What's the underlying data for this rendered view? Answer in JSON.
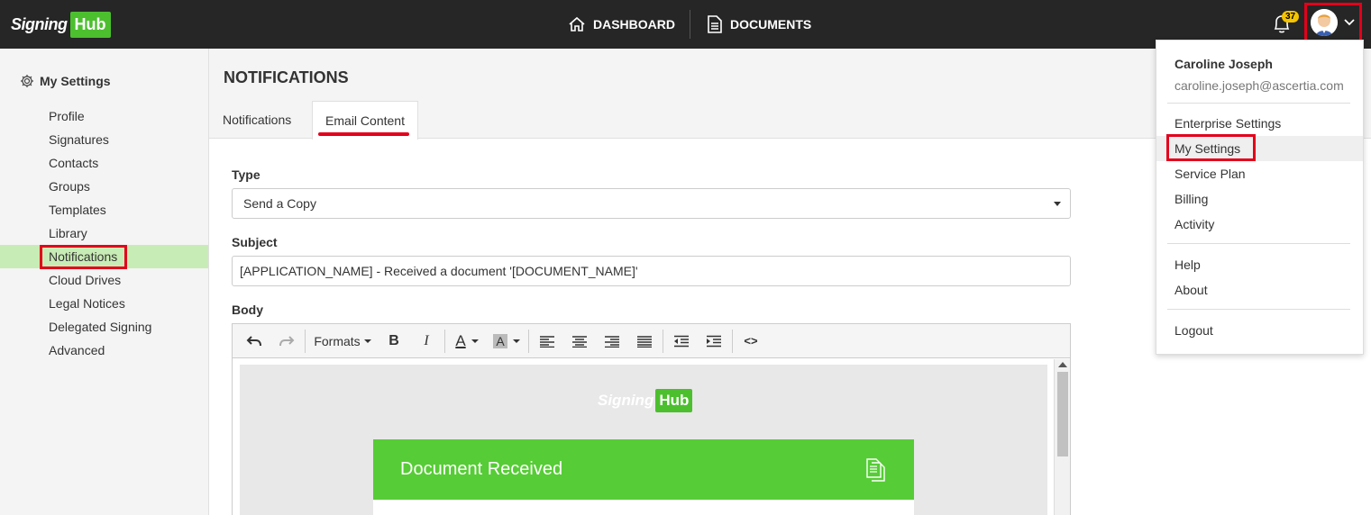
{
  "header": {
    "logo_part1": "Signing",
    "logo_part2": "Hub",
    "nav": [
      {
        "label": "DASHBOARD",
        "icon": "home-icon"
      },
      {
        "label": "DOCUMENTS",
        "icon": "document-icon"
      }
    ],
    "notification_count": "37"
  },
  "sidebar": {
    "title": "My Settings",
    "items": [
      {
        "label": "Profile"
      },
      {
        "label": "Signatures"
      },
      {
        "label": "Contacts"
      },
      {
        "label": "Groups"
      },
      {
        "label": "Templates"
      },
      {
        "label": "Library"
      },
      {
        "label": "Notifications",
        "active": true
      },
      {
        "label": "Cloud Drives"
      },
      {
        "label": "Legal Notices"
      },
      {
        "label": "Delegated Signing"
      },
      {
        "label": "Advanced"
      }
    ]
  },
  "main": {
    "title": "NOTIFICATIONS",
    "tabs": [
      {
        "label": "Notifications"
      },
      {
        "label": "Email Content",
        "active": true
      }
    ],
    "type_label": "Type",
    "type_value": "Send a Copy",
    "subject_label": "Subject",
    "subject_value": "[APPLICATION_NAME] - Received a document '[DOCUMENT_NAME]'",
    "body_label": "Body",
    "toolbar": {
      "formats_label": "Formats",
      "bold": "B",
      "italic": "I",
      "font_color": "A",
      "bg_color": "A",
      "code": "<>"
    },
    "email_preview": {
      "logo_part1": "Signing",
      "logo_part2": "Hub",
      "card_title": "Document Received"
    }
  },
  "user_menu": {
    "name": "Caroline Joseph",
    "email": "caroline.joseph@ascertia.com",
    "items_group1": [
      "Enterprise Settings",
      "My Settings",
      "Service Plan",
      "Billing",
      "Activity"
    ],
    "items_group2": [
      "Help",
      "About"
    ],
    "items_group3": [
      "Logout"
    ]
  },
  "colors": {
    "topbar": "#262626",
    "brand_green": "#4cbf2e",
    "highlight_red": "#e3001b",
    "sidebar_active": "#c8ecb5",
    "badge": "#f5c400"
  }
}
